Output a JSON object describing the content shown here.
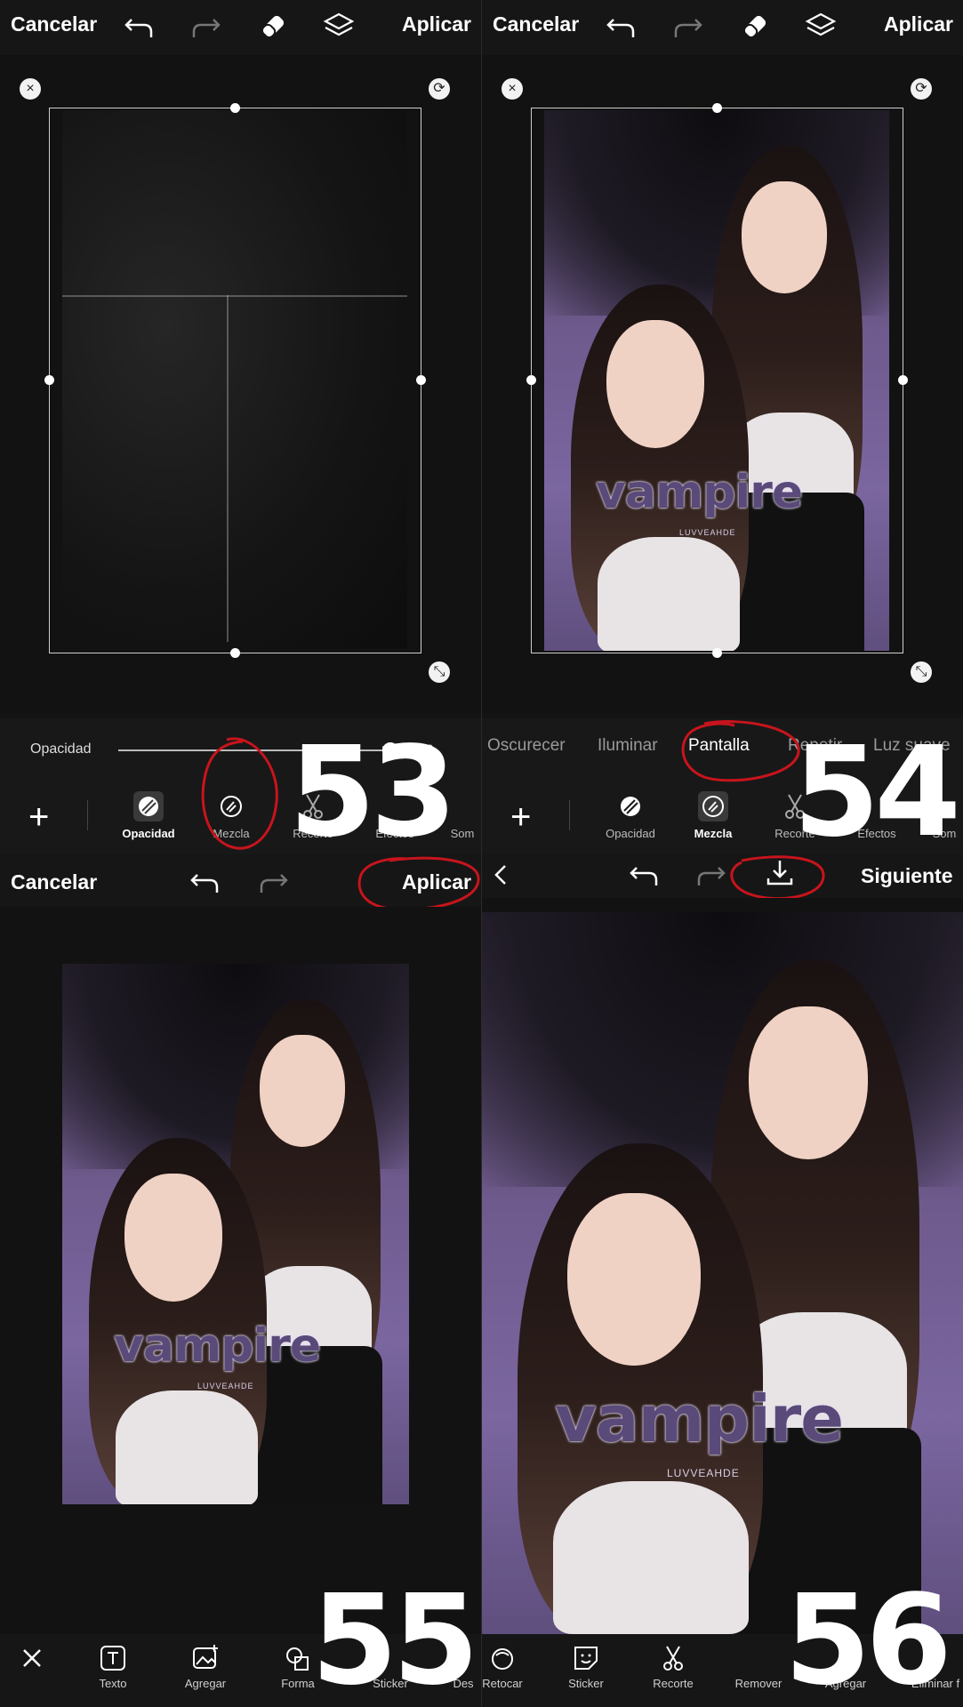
{
  "panels": {
    "p53": {
      "cancel": "Cancelar",
      "apply": "Aplicar",
      "opacity_label": "Opacidad",
      "opacity_value": "100",
      "step": "53",
      "tools": [
        "Opacidad",
        "Mezcla",
        "Recorte",
        "Efectos",
        "Som"
      ]
    },
    "p54": {
      "cancel": "Cancelar",
      "apply": "Aplicar",
      "blend_modes": [
        "Oscurecer",
        "Iluminar",
        "Pantalla",
        "Repetir",
        "Luz suave"
      ],
      "selected_blend": "Pantalla",
      "step": "54",
      "tools": [
        "Opacidad",
        "Mezcla",
        "Recorte",
        "Efectos",
        "Som"
      ],
      "photo_text": "vampire",
      "photo_sub": "LUVVEAHDE"
    },
    "p55": {
      "cancel": "Cancelar",
      "apply": "Aplicar",
      "step": "55",
      "tools": [
        "Texto",
        "Agregar",
        "Forma",
        "Sticker",
        "Des"
      ],
      "photo_text": "vampire",
      "photo_sub": "LUVVEAHDE"
    },
    "p56": {
      "next": "Siguiente",
      "step": "56",
      "tools": [
        "Retocar",
        "Sticker",
        "Recorte",
        "Remover",
        "Agregar",
        "Eliminar f"
      ],
      "photo_text": "vampire",
      "photo_sub": "LUVVEAHDE"
    }
  },
  "colors": {
    "annotation": "#c8141c",
    "background": "#141414",
    "photo_purple": "#7b66a0"
  }
}
